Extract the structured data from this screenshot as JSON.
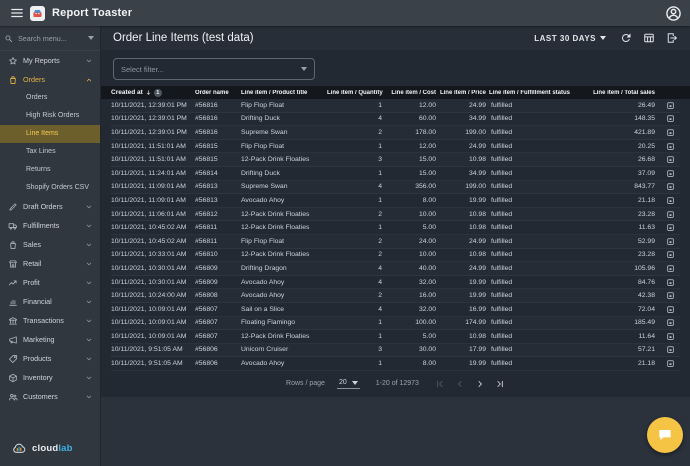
{
  "topbar": {
    "title": "Report Toaster"
  },
  "sidebar": {
    "search_placeholder": "Search menu...",
    "items": [
      {
        "label": "My Reports",
        "icon": "star",
        "chevron": "down"
      },
      {
        "label": "Orders",
        "icon": "bag",
        "chevron": "up",
        "active": true,
        "children": [
          "Orders",
          "High Risk Orders",
          "Line Items",
          "Tax Lines",
          "Returns",
          "Shopify Orders CSV"
        ],
        "selected_child": "Line Items"
      },
      {
        "label": "Draft Orders",
        "icon": "pencil",
        "chevron": "down"
      },
      {
        "label": "Fulfillments",
        "icon": "truck",
        "chevron": "down"
      },
      {
        "label": "Sales",
        "icon": "bag",
        "chevron": "down"
      },
      {
        "label": "Retail",
        "icon": "store",
        "chevron": "down"
      },
      {
        "label": "Profit",
        "icon": "trend",
        "chevron": "down"
      },
      {
        "label": "Financial",
        "icon": "chart",
        "chevron": "down"
      },
      {
        "label": "Transactions",
        "icon": "bank",
        "chevron": "down"
      },
      {
        "label": "Marketing",
        "icon": "megaphone",
        "chevron": "down"
      },
      {
        "label": "Products",
        "icon": "tag",
        "chevron": "down"
      },
      {
        "label": "Inventory",
        "icon": "box",
        "chevron": "down"
      },
      {
        "label": "Customers",
        "icon": "people",
        "chevron": "down"
      }
    ],
    "logo": {
      "part1": "cloud",
      "part2": "lab"
    }
  },
  "main": {
    "title": "Order Line Items (test data)",
    "date_range": "LAST 30 DAYS",
    "filter_placeholder": "Select filter...",
    "table": {
      "sort": {
        "column": "Created at",
        "direction": "desc",
        "order": "1"
      },
      "columns": [
        {
          "label": "Created at",
          "align": "left",
          "key": "created-at"
        },
        {
          "label": "Order name",
          "align": "left",
          "key": "order-name"
        },
        {
          "label": "Line item / Product title",
          "align": "left",
          "key": "product-title"
        },
        {
          "label": "Line item / Quantity",
          "align": "right",
          "key": "quantity"
        },
        {
          "label": "Line item / Cost",
          "align": "right",
          "key": "cost"
        },
        {
          "label": "Line item / Price",
          "align": "right",
          "key": "price"
        },
        {
          "label": "Line item / Fulfillment status",
          "align": "left",
          "key": "fulfillment-status"
        },
        {
          "label": "Line item / Total sales",
          "align": "right",
          "key": "total-sales"
        }
      ],
      "rows": [
        [
          "10/11/2021, 12:39:01 PM",
          "#56816",
          "Flip Flop Float",
          "1",
          "12.00",
          "24.99",
          "fulfilled",
          "26.49"
        ],
        [
          "10/11/2021, 12:39:01 PM",
          "#56816",
          "Drifting Duck",
          "4",
          "60.00",
          "34.99",
          "fulfilled",
          "148.35"
        ],
        [
          "10/11/2021, 12:39:01 PM",
          "#56816",
          "Supreme Swan",
          "2",
          "178.00",
          "199.00",
          "fulfilled",
          "421.89"
        ],
        [
          "10/11/2021, 11:51:01 AM",
          "#56815",
          "Flip Flop Float",
          "1",
          "12.00",
          "24.99",
          "fulfilled",
          "20.25"
        ],
        [
          "10/11/2021, 11:51:01 AM",
          "#56815",
          "12-Pack Drink Floaties",
          "3",
          "15.00",
          "10.98",
          "fulfilled",
          "26.68"
        ],
        [
          "10/11/2021, 11:24:01 AM",
          "#56814",
          "Drifting Duck",
          "1",
          "15.00",
          "34.99",
          "fulfilled",
          "37.09"
        ],
        [
          "10/11/2021, 11:09:01 AM",
          "#56813",
          "Supreme Swan",
          "4",
          "356.00",
          "199.00",
          "fulfilled",
          "843.77"
        ],
        [
          "10/11/2021, 11:09:01 AM",
          "#56813",
          "Avocado Ahoy",
          "1",
          "8.00",
          "19.99",
          "fulfilled",
          "21.18"
        ],
        [
          "10/11/2021, 11:06:01 AM",
          "#56812",
          "12-Pack Drink Floaties",
          "2",
          "10.00",
          "10.98",
          "fulfilled",
          "23.28"
        ],
        [
          "10/11/2021, 10:45:02 AM",
          "#56811",
          "12-Pack Drink Floaties",
          "1",
          "5.00",
          "10.98",
          "fulfilled",
          "11.63"
        ],
        [
          "10/11/2021, 10:45:02 AM",
          "#56811",
          "Flip Flop Float",
          "2",
          "24.00",
          "24.99",
          "fulfilled",
          "52.99"
        ],
        [
          "10/11/2021, 10:33:01 AM",
          "#56810",
          "12-Pack Drink Floaties",
          "2",
          "10.00",
          "10.98",
          "fulfilled",
          "23.28"
        ],
        [
          "10/11/2021, 10:30:01 AM",
          "#56809",
          "Drifting Dragon",
          "4",
          "40.00",
          "24.99",
          "fulfilled",
          "105.96"
        ],
        [
          "10/11/2021, 10:30:01 AM",
          "#56809",
          "Avocado Ahoy",
          "4",
          "32.00",
          "19.99",
          "fulfilled",
          "84.76"
        ],
        [
          "10/11/2021, 10:24:00 AM",
          "#56808",
          "Avocado Ahoy",
          "2",
          "16.00",
          "19.99",
          "fulfilled",
          "42.38"
        ],
        [
          "10/11/2021, 10:09:01 AM",
          "#56807",
          "Sail on a Slice",
          "4",
          "32.00",
          "16.99",
          "fulfilled",
          "72.04"
        ],
        [
          "10/11/2021, 10:09:01 AM",
          "#56807",
          "Floating Flamingo",
          "1",
          "100.00",
          "174.99",
          "fulfilled",
          "185.49"
        ],
        [
          "10/11/2021, 10:09:01 AM",
          "#56807",
          "12-Pack Drink Floaties",
          "1",
          "5.00",
          "10.98",
          "fulfilled",
          "11.64"
        ],
        [
          "10/11/2021, 9:51:05 AM",
          "#56806",
          "Unicorn Cruiser",
          "3",
          "30.00",
          "17.99",
          "fulfilled",
          "57.21"
        ],
        [
          "10/11/2021, 9:51:05 AM",
          "#56806",
          "Avocado Ahoy",
          "1",
          "8.00",
          "19.99",
          "fulfilled",
          "21.18"
        ]
      ]
    },
    "pagination": {
      "rows_per_page_label": "Rows / page",
      "rows_per_page": "20",
      "range": "1-20 of 12973",
      "nav": [
        {
          "name": "first-page",
          "enabled": false
        },
        {
          "name": "prev-page",
          "enabled": false
        },
        {
          "name": "next-page",
          "enabled": true
        },
        {
          "name": "last-page",
          "enabled": true
        }
      ]
    }
  },
  "icons": {
    "topbar": [
      "menu-icon",
      "app-logo-toaster-icon",
      "account-icon"
    ],
    "toolbar": [
      "refresh-icon",
      "table-view-icon",
      "export-icon"
    ],
    "row_action": "open-record-icon",
    "fab": "chat-icon"
  },
  "colors": {
    "accent_gold": "#e6b441",
    "selected_bg": "#6d5f2b",
    "selected_text": "#f6ca55",
    "fab_yellow": "#f6c445",
    "brand_blue": "#3fb0e4",
    "header_row_bg": "#14181c"
  }
}
